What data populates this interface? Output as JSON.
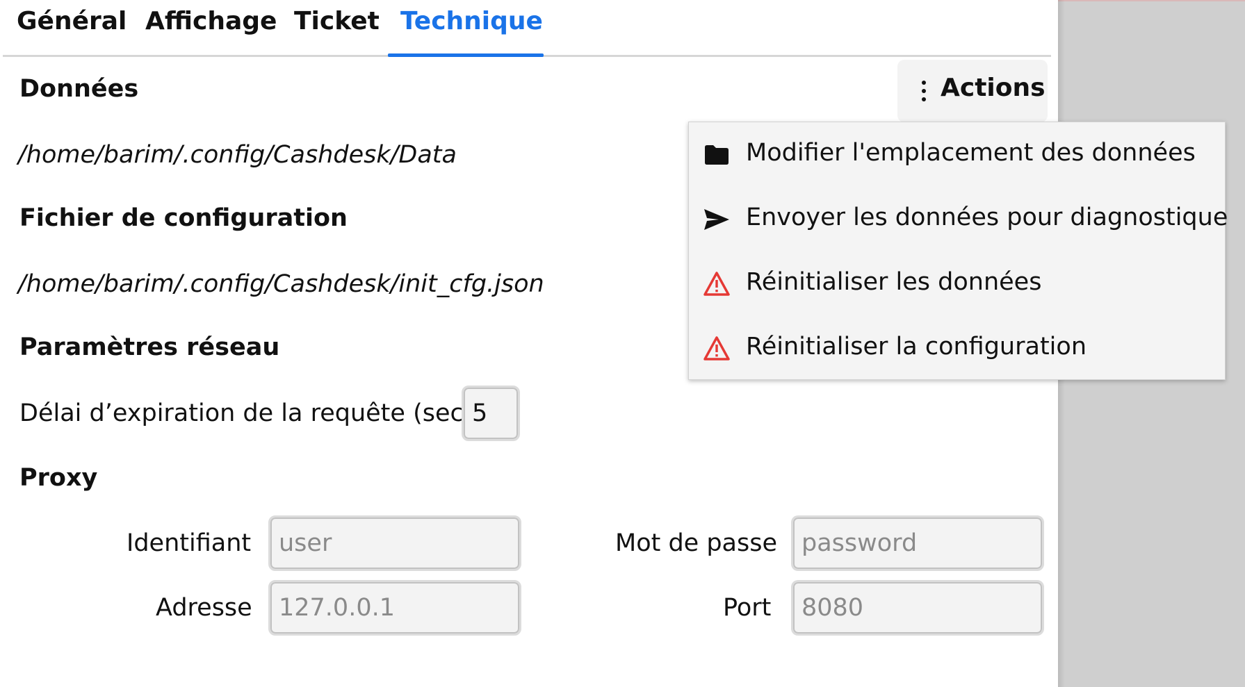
{
  "tabs": [
    {
      "label": "Général",
      "active": false
    },
    {
      "label": "Affichage",
      "active": false
    },
    {
      "label": "Ticket",
      "active": false
    },
    {
      "label": "Technique",
      "active": true
    }
  ],
  "data_section": {
    "title": "Données",
    "path": "/home/barim/.config/Cashdesk/Data"
  },
  "config_section": {
    "title": "Fichier de configuration",
    "path": "/home/barim/.config/Cashdesk/init_cfg.json"
  },
  "network_section": {
    "title": "Paramètres réseau",
    "timeout_label": "Délai d’expiration de la requête (sec)",
    "timeout_value": "5"
  },
  "proxy_section": {
    "title": "Proxy",
    "username_label": "Identifiant",
    "username_placeholder": "user",
    "password_label": "Mot de passe",
    "password_placeholder": "password",
    "address_label": "Adresse",
    "address_placeholder": "127.0.0.1",
    "port_label": "Port",
    "port_placeholder": "8080"
  },
  "actions": {
    "button_label": "Actions",
    "button_icon": "kebab-vertical-icon",
    "menu_items": [
      {
        "label": "Modifier l'emplacement des données",
        "icon": "folder-icon"
      },
      {
        "label": "Envoyer les données pour diagnostique",
        "icon": "send-icon"
      },
      {
        "label": "Réinitialiser les données",
        "icon": "warning-icon"
      },
      {
        "label": "Réinitialiser la configuration",
        "icon": "warning-icon"
      }
    ]
  },
  "colors": {
    "accent": "#1a73e8",
    "warning": "#e53935",
    "side_panel": "#cfcfcf"
  }
}
